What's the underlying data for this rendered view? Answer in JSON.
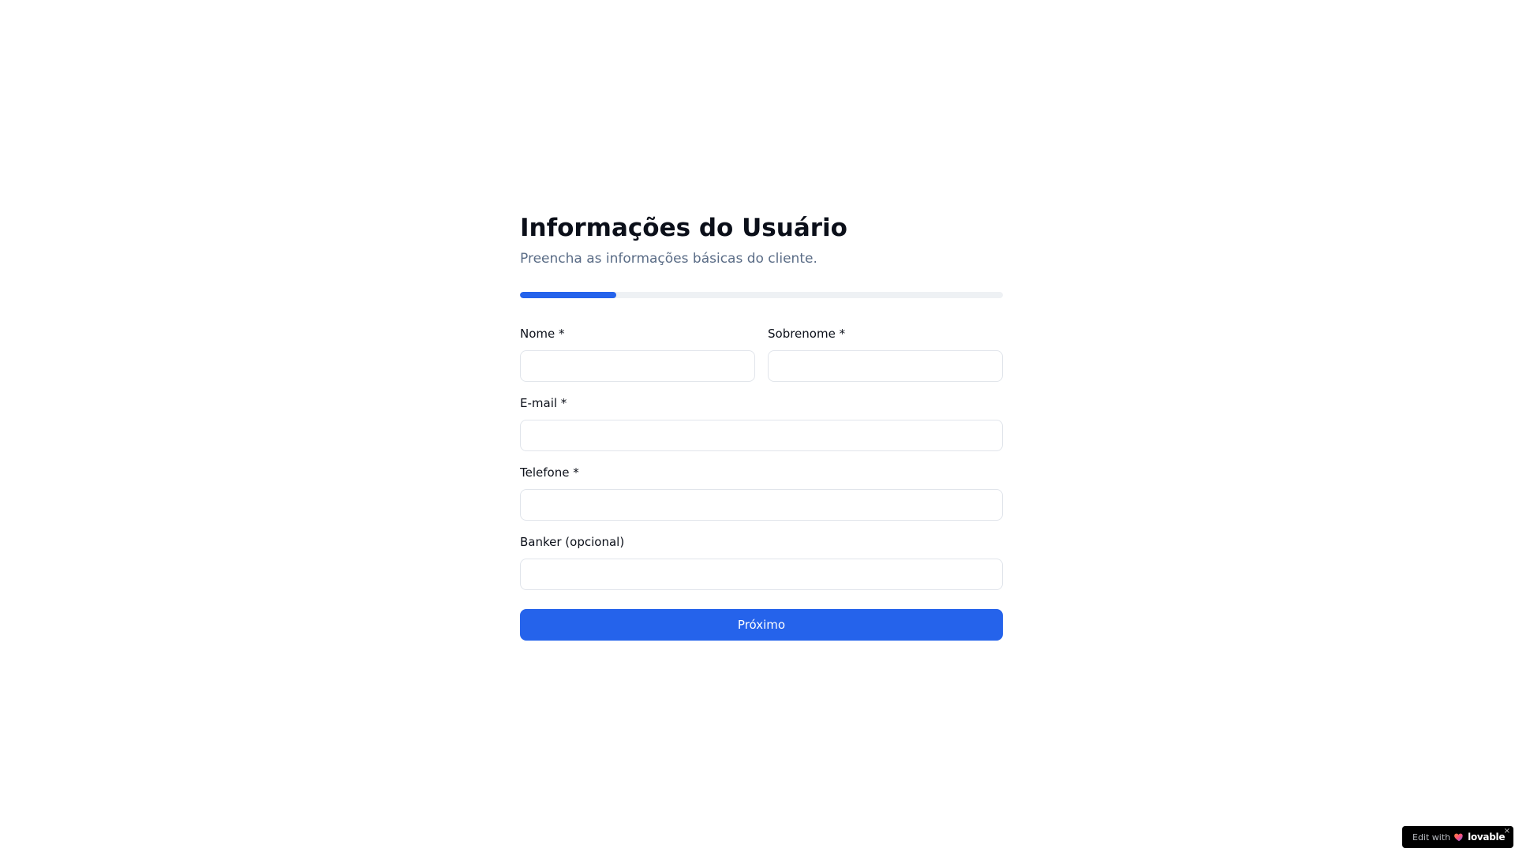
{
  "form": {
    "title": "Informações do Usuário",
    "subtitle": "Preencha as informações básicas do cliente.",
    "progress": {
      "value": 0.2,
      "color": "#2563eb",
      "track_color": "#eef1f4"
    },
    "fields": {
      "first_name": {
        "label": "Nome *",
        "value": "",
        "placeholder": ""
      },
      "last_name": {
        "label": "Sobrenome *",
        "value": "",
        "placeholder": ""
      },
      "email": {
        "label": "E-mail *",
        "value": "",
        "placeholder": ""
      },
      "phone": {
        "label": "Telefone *",
        "value": "",
        "placeholder": ""
      },
      "banker": {
        "label": "Banker (opcional)",
        "value": "",
        "placeholder": ""
      }
    },
    "submit_label": "Próximo",
    "accent_color": "#2563eb"
  },
  "badge": {
    "prefix": "Edit with",
    "brand": "lovable",
    "icon": "lovable-heart-icon",
    "close_icon": "close-icon",
    "close_glyph": "×"
  }
}
